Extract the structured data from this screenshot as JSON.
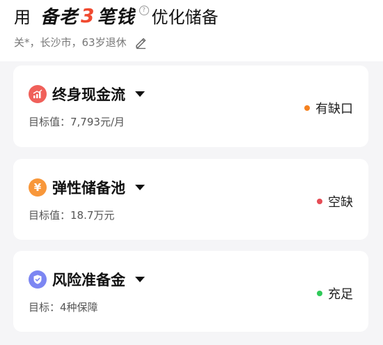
{
  "header": {
    "prefix": "用",
    "brand_part1": "备老",
    "brand_three": "3",
    "brand_part2": "笔钱",
    "suffix": "优化储备",
    "help_symbol": "?",
    "subtitle": "关*，长沙市，63岁退休",
    "edit_icon": "pencil-icon"
  },
  "cards": [
    {
      "name": "终身现金流",
      "target": "目标值：7,793元/月",
      "status": "有缺口",
      "status_color": "#f5811f",
      "icon": "chart-icon",
      "icon_color": "#f0605a"
    },
    {
      "name": "弹性储备池",
      "target": "目标值：18.7万元",
      "status": "空缺",
      "status_color": "#e54c55",
      "icon": "yen-icon",
      "icon_color": "#f8973a",
      "icon_glyph": "¥"
    },
    {
      "name": "风险准备金",
      "target": "目标：4种保障",
      "status": "充足",
      "status_color": "#2fc959",
      "icon": "shield-check-icon",
      "icon_color": "#7c86f2"
    }
  ]
}
